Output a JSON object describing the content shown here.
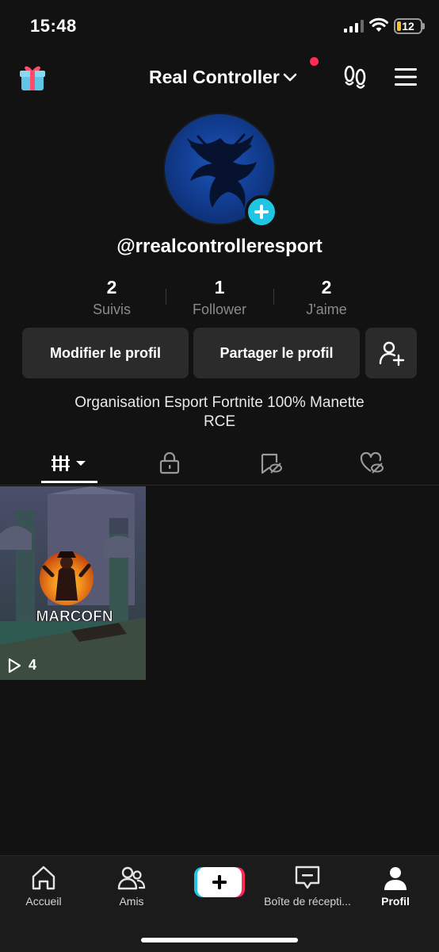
{
  "status_bar": {
    "time": "15:48",
    "battery": "12"
  },
  "header": {
    "account_name": "Real Controller"
  },
  "profile": {
    "username": "@rrealcontrolleresport",
    "stats": [
      {
        "value": "2",
        "label": "Suivis"
      },
      {
        "value": "1",
        "label": "Follower"
      },
      {
        "value": "2",
        "label": "J'aime"
      }
    ],
    "edit_label": "Modifier le profil",
    "share_label": "Partager le profil",
    "bio_line1": "Organisation Esport Fortnite 100% Manette",
    "bio_line2": "RCE"
  },
  "tabs": [
    "videos-grid-icon",
    "lock-icon",
    "reposts-icon",
    "liked-icon"
  ],
  "videos": [
    {
      "overlay_text": "MARCOFN",
      "views": "4"
    }
  ],
  "bottom_nav": {
    "home": "Accueil",
    "friends": "Amis",
    "inbox": "Boîte de récepti...",
    "profile": "Profil"
  },
  "colors": {
    "accent_cyan": "#20c5e3",
    "accent_red": "#fe2c55",
    "background": "#121212"
  }
}
